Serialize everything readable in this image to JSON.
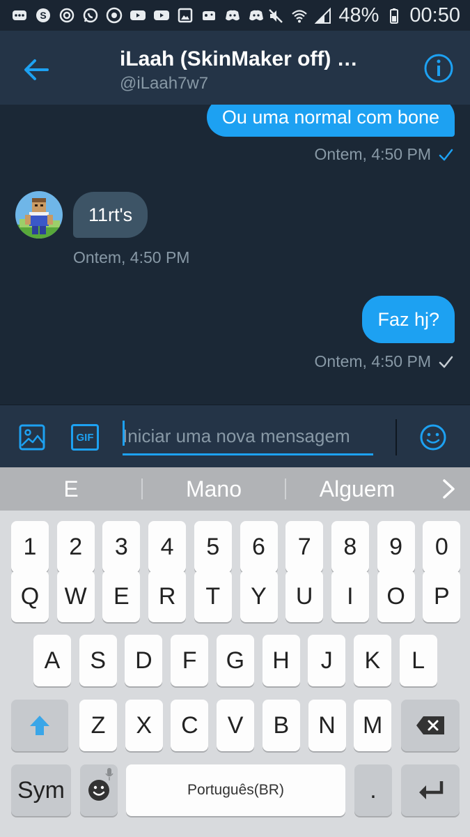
{
  "status_bar": {
    "battery": "48%",
    "time": "00:50",
    "notification_icons": [
      "more-icon",
      "skype-icon",
      "power-icon",
      "whatsapp-icon",
      "chrome-icon",
      "youtube-icon",
      "youtube-icon",
      "gallery-icon",
      "gamepad-icon",
      "discord-icon",
      "discord-icon"
    ]
  },
  "header": {
    "title": "iLaah (SkinMaker off) …",
    "handle": "@iLaah7w7"
  },
  "messages": [
    {
      "direction": "outgoing",
      "text": "Ou uma normal com bone",
      "time": "Ontem, 4:50 PM",
      "read": true
    },
    {
      "direction": "incoming",
      "text": "11rt's",
      "time": "Ontem, 4:50 PM"
    },
    {
      "direction": "outgoing",
      "text": "Faz hj?",
      "time": "Ontem, 4:50 PM",
      "read": false
    }
  ],
  "composer": {
    "placeholder": "Iniciar uma nova mensagem",
    "gif_label": "GIF"
  },
  "keyboard": {
    "suggestions": [
      "E",
      "Mano",
      "Alguem"
    ],
    "number_row": [
      "1",
      "2",
      "3",
      "4",
      "5",
      "6",
      "7",
      "8",
      "9",
      "0"
    ],
    "row1": [
      "Q",
      "W",
      "E",
      "R",
      "T",
      "Y",
      "U",
      "I",
      "O",
      "P"
    ],
    "row2": [
      "A",
      "S",
      "D",
      "F",
      "G",
      "H",
      "J",
      "K",
      "L"
    ],
    "row3": [
      "Z",
      "X",
      "C",
      "V",
      "B",
      "N",
      "M"
    ],
    "sym_label": "Sym",
    "space_label": "Português(BR)",
    "period": "."
  },
  "colors": {
    "accent": "#1da1f2",
    "header_bg": "#243447",
    "conversation_bg": "#1b2836",
    "incoming_bubble": "#3d5466",
    "muted_text": "#8899a6"
  }
}
